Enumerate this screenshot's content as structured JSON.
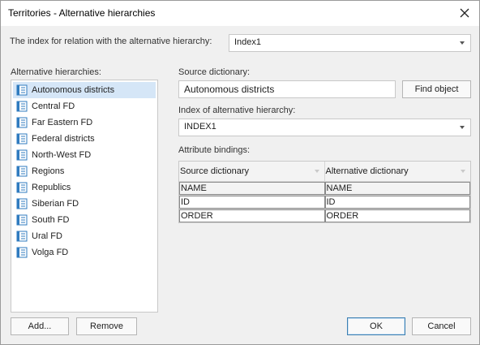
{
  "dialog": {
    "title": "Territories - Alternative hierarchies",
    "close_icon": "close-icon"
  },
  "relation_index": {
    "label": "The index for relation with the alternative hierarchy:",
    "value": "Index1"
  },
  "hierarchies": {
    "label": "Alternative hierarchies:",
    "item_icon": "dictionary-icon",
    "items": [
      {
        "label": "Autonomous districts",
        "selected": true
      },
      {
        "label": "Central FD"
      },
      {
        "label": "Far Eastern FD"
      },
      {
        "label": "Federal districts"
      },
      {
        "label": "North-West FD"
      },
      {
        "label": "Regions"
      },
      {
        "label": "Republics"
      },
      {
        "label": "Siberian FD"
      },
      {
        "label": "South FD"
      },
      {
        "label": "Ural FD"
      },
      {
        "label": "Volga FD"
      }
    ],
    "add_label": "Add...",
    "remove_label": "Remove"
  },
  "source_dictionary": {
    "label": "Source dictionary:",
    "value": "Autonomous districts",
    "find_label": "Find object"
  },
  "alt_index": {
    "label": "Index of alternative hierarchy:",
    "value": "INDEX1"
  },
  "bindings": {
    "label": "Attribute bindings:",
    "columns": [
      "Source dictionary",
      "Alternative dictionary"
    ],
    "rows": [
      [
        "NAME",
        "NAME"
      ],
      [
        "ID",
        "ID"
      ],
      [
        "ORDER",
        "ORDER"
      ]
    ]
  },
  "footer": {
    "ok_label": "OK",
    "cancel_label": "Cancel"
  },
  "colors": {
    "selection": "#d5e6f7",
    "icon": "#2f7bbf",
    "default_button_border": "#3c7fb1"
  }
}
